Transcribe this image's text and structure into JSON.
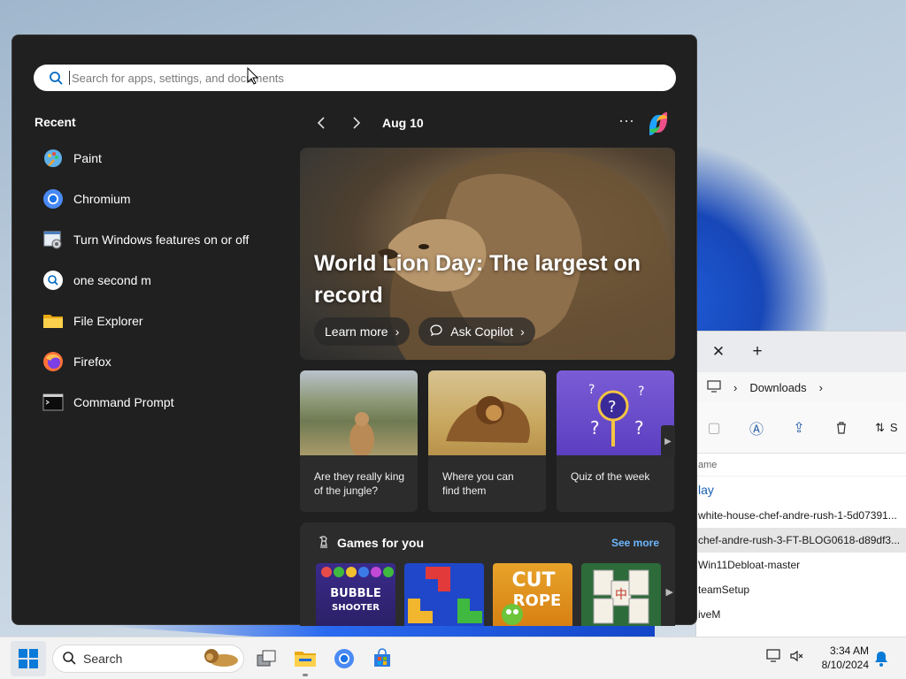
{
  "start_menu": {
    "search": {
      "placeholder": "Search for apps, settings, and documents"
    },
    "recent": {
      "title": "Recent",
      "items": [
        {
          "label": "Paint",
          "icon": "paint-icon"
        },
        {
          "label": "Chromium",
          "icon": "chromium-icon"
        },
        {
          "label": "Turn Windows features on or off",
          "icon": "windows-features-icon"
        },
        {
          "label": "one second m",
          "icon": "search-result-icon"
        },
        {
          "label": "File Explorer",
          "icon": "file-explorer-icon"
        },
        {
          "label": "Firefox",
          "icon": "firefox-icon"
        },
        {
          "label": "Command Prompt",
          "icon": "command-prompt-icon"
        }
      ]
    },
    "feed": {
      "date": "Aug 10",
      "hero": {
        "title": "World Lion Day: The largest on record",
        "learn_more": "Learn more",
        "ask_copilot": "Ask Copilot"
      },
      "cards": [
        {
          "text": "Are they really king of the jungle?"
        },
        {
          "text": "Where you can find them"
        },
        {
          "text": "Quiz of the week"
        }
      ],
      "games": {
        "title": "Games for you",
        "see_more": "See more",
        "items": [
          "Bubble Shooter",
          "Block puzzle",
          "Cut the Rope",
          "Mahjong"
        ]
      }
    }
  },
  "explorer": {
    "breadcrumb": "Downloads",
    "toolbar_sort": "S",
    "column_header": "ame",
    "group_label": "lay",
    "rows": [
      "white-house-chef-andre-rush-1-5d07391...",
      "chef-andre-rush-3-FT-BLOG0618-d89df3...",
      "Win11Debloat-master",
      "teamSetup",
      "iveM"
    ]
  },
  "taskbar": {
    "search_label": "Search",
    "time": "3:34 AM",
    "date": "8/10/2024"
  },
  "colors": {
    "start_bg": "#202020",
    "accent": "#0067c0",
    "link": "#6cb6ff"
  }
}
